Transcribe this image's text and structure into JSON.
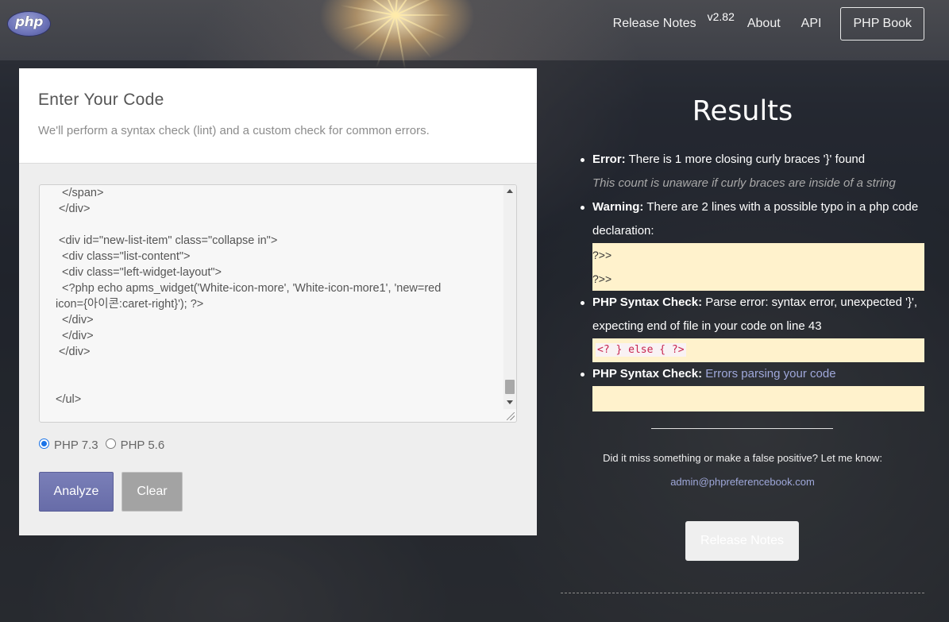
{
  "header": {
    "logo_text": "php",
    "nav": {
      "release_notes": "Release Notes",
      "version": "v2.82",
      "about": "About",
      "api": "API",
      "php_book": "PHP Book"
    }
  },
  "editor_card": {
    "title": "Enter Your Code",
    "subtitle": "We'll perform a syntax check (lint) and a custom check for common errors.",
    "code_lines": [
      "  </span>",
      " </div>",
      "",
      " <div id=\"new-list-item\" class=\"collapse in\">",
      "  <div class=\"list-content\">",
      "  <div class=\"left-widget-layout\">",
      "  <?php echo apms_widget('White-icon-more', 'White-icon-more1', 'new=red",
      "icon={아이콘:caret-right}'); ?>",
      "  </div>",
      "  </div>",
      " </div>",
      "",
      "",
      "</ul>"
    ],
    "php_versions": [
      {
        "label": "PHP 7.3",
        "checked": true
      },
      {
        "label": "PHP 5.6",
        "checked": false
      }
    ],
    "analyze_label": "Analyze",
    "clear_label": "Clear"
  },
  "results": {
    "title": "Results",
    "items": [
      {
        "label": "Error:",
        "text": " There is 1 more closing curly braces '}' found",
        "note": "This count is unaware if curly braces are inside of a string"
      },
      {
        "label": "Warning:",
        "text": " There are 2 lines with a possible typo in a php code declaration:",
        "code": [
          "?>>",
          "?>>"
        ]
      },
      {
        "label": "PHP Syntax Check:",
        "text": " Parse error: syntax error, unexpected '}', expecting end of file in your code on line 43",
        "code": [
          "<? } else { ?>"
        ]
      },
      {
        "label": "PHP Syntax Check:",
        "link": "Errors parsing your code"
      }
    ],
    "feedback": "Did it miss something or make a false positive? Let me know:",
    "email": "admin@phpreferencebook.com",
    "release_button": "Release Notes"
  }
}
